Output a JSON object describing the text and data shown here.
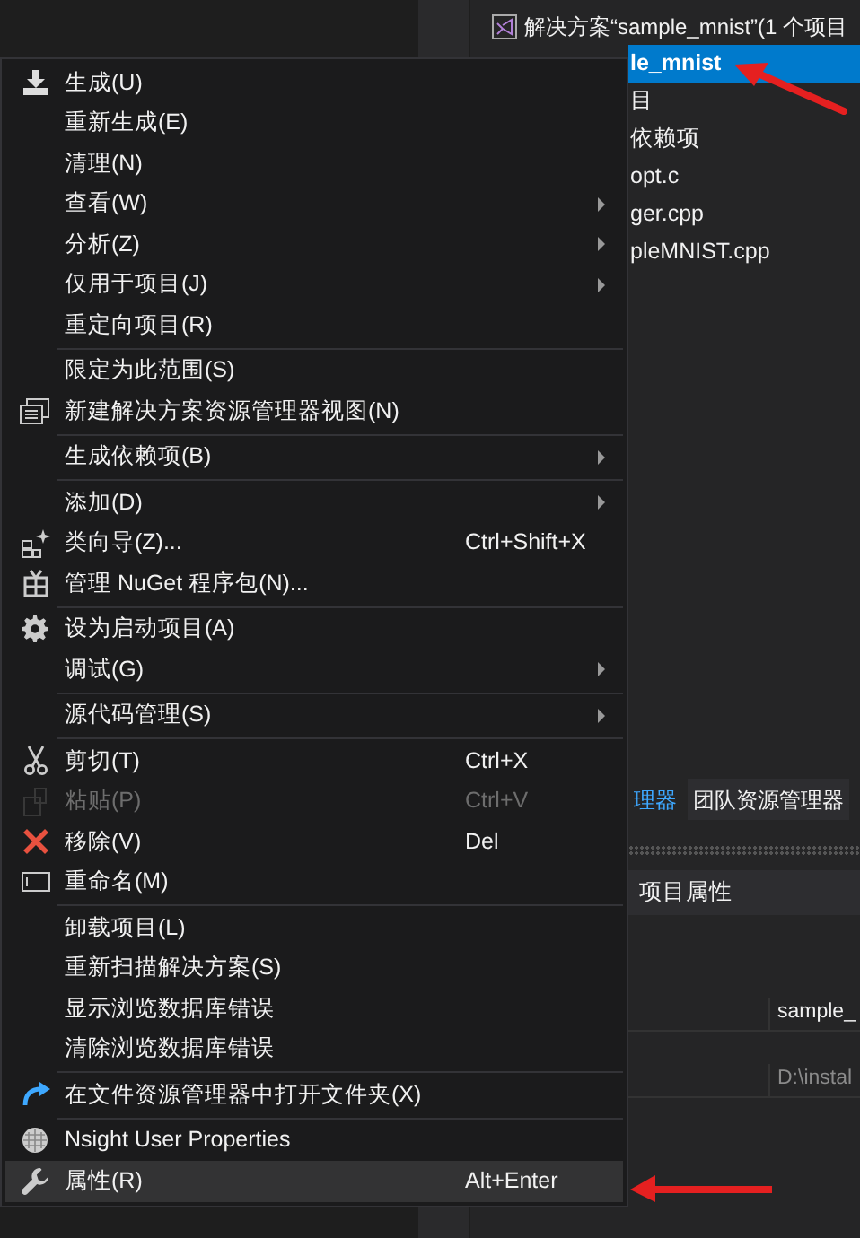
{
  "solution_explorer": {
    "solution": "解决方案“sample_mnist”(1 个项目",
    "project": {
      "label": "le_mnist",
      "selected": true
    },
    "items": [
      "目",
      "依赖项",
      "opt.c",
      "ger.cpp",
      "pleMNIST.cpp"
    ]
  },
  "tabs": [
    {
      "label": "理器",
      "selected": true
    },
    {
      "label": "团队资源管理器",
      "selected": false
    }
  ],
  "properties": {
    "title": "项目属性",
    "rows": [
      {
        "value": "sample_",
        "disabled": false
      },
      {
        "value": "D:\\instal",
        "disabled": true
      }
    ]
  },
  "context_menu": [
    {
      "kind": "item",
      "label": "生成(U)",
      "submenu": false,
      "disabled": false,
      "selected": false
    },
    {
      "kind": "item",
      "label": "重新生成(E)",
      "submenu": false,
      "disabled": false,
      "selected": false
    },
    {
      "kind": "item",
      "label": "清理(N)",
      "submenu": false,
      "disabled": false,
      "selected": false
    },
    {
      "kind": "item",
      "label": "查看(W)",
      "submenu": true,
      "disabled": false,
      "selected": false
    },
    {
      "kind": "item",
      "label": "分析(Z)",
      "submenu": true,
      "disabled": false,
      "selected": false
    },
    {
      "kind": "item",
      "label": "仅用于项目(J)",
      "submenu": true,
      "disabled": false,
      "selected": false
    },
    {
      "kind": "item",
      "label": "重定向项目(R)",
      "submenu": false,
      "disabled": false,
      "selected": false
    },
    {
      "kind": "separator"
    },
    {
      "kind": "item",
      "label": "限定为此范围(S)",
      "submenu": false,
      "disabled": false,
      "selected": false
    },
    {
      "kind": "item",
      "label": "新建解决方案资源管理器视图(N)",
      "submenu": false,
      "disabled": false,
      "selected": false
    },
    {
      "kind": "separator"
    },
    {
      "kind": "item",
      "label": "生成依赖项(B)",
      "submenu": true,
      "disabled": false,
      "selected": false
    },
    {
      "kind": "separator"
    },
    {
      "kind": "item",
      "label": "添加(D)",
      "submenu": true,
      "disabled": false,
      "selected": false
    },
    {
      "kind": "item",
      "label": "类向导(Z)...",
      "shortcut": "Ctrl+Shift+X",
      "submenu": false,
      "disabled": false,
      "selected": false
    },
    {
      "kind": "item",
      "label": "管理 NuGet 程序包(N)...",
      "submenu": false,
      "disabled": false,
      "selected": false
    },
    {
      "kind": "separator"
    },
    {
      "kind": "item",
      "label": "设为启动项目(A)",
      "submenu": false,
      "disabled": false,
      "selected": false
    },
    {
      "kind": "item",
      "label": "调试(G)",
      "submenu": true,
      "disabled": false,
      "selected": false
    },
    {
      "kind": "separator"
    },
    {
      "kind": "item",
      "label": "源代码管理(S)",
      "submenu": true,
      "disabled": false,
      "selected": false
    },
    {
      "kind": "separator"
    },
    {
      "kind": "item",
      "label": "剪切(T)",
      "shortcut": "Ctrl+X",
      "submenu": false,
      "disabled": false,
      "selected": false
    },
    {
      "kind": "item",
      "label": "粘贴(P)",
      "shortcut": "Ctrl+V",
      "submenu": false,
      "disabled": true,
      "selected": false
    },
    {
      "kind": "item",
      "label": "移除(V)",
      "shortcut": "Del",
      "submenu": false,
      "disabled": false,
      "selected": false
    },
    {
      "kind": "item",
      "label": "重命名(M)",
      "submenu": false,
      "disabled": false,
      "selected": false
    },
    {
      "kind": "separator"
    },
    {
      "kind": "item",
      "label": "卸载项目(L)",
      "submenu": false,
      "disabled": false,
      "selected": false
    },
    {
      "kind": "item",
      "label": "重新扫描解决方案(S)",
      "submenu": false,
      "disabled": false,
      "selected": false
    },
    {
      "kind": "item",
      "label": "显示浏览数据库错误",
      "submenu": false,
      "disabled": false,
      "selected": false
    },
    {
      "kind": "item",
      "label": "清除浏览数据库错误",
      "submenu": false,
      "disabled": false,
      "selected": false
    },
    {
      "kind": "separator"
    },
    {
      "kind": "item",
      "label": "在文件资源管理器中打开文件夹(X)",
      "submenu": false,
      "disabled": false,
      "selected": false
    },
    {
      "kind": "separator"
    },
    {
      "kind": "item",
      "label": "Nsight User Properties",
      "submenu": false,
      "disabled": false,
      "selected": false
    },
    {
      "kind": "item",
      "label": "属性(R)",
      "shortcut": "Alt+Enter",
      "submenu": false,
      "disabled": false,
      "selected": true
    }
  ]
}
